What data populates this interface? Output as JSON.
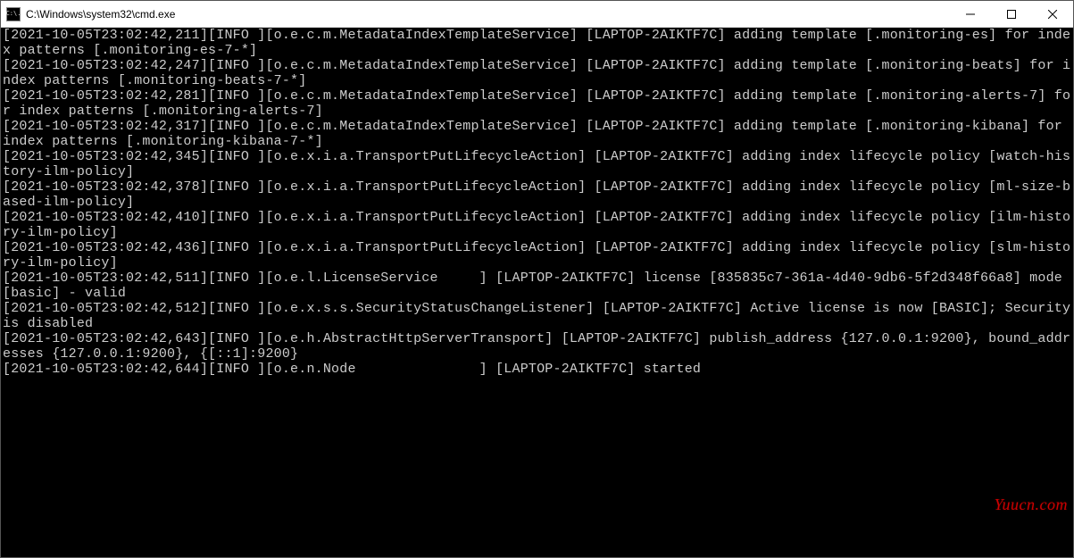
{
  "window": {
    "title": "C:\\Windows\\system32\\cmd.exe",
    "app_icon_label": "C:\\."
  },
  "controls": {
    "minimize": "Minimize",
    "maximize": "Maximize",
    "close": "Close"
  },
  "watermark": "Yuucn.com",
  "console_lines": [
    "[2021-10-05T23:02:42,211][INFO ][o.e.c.m.MetadataIndexTemplateService] [LAPTOP-2AIKTF7C] adding template [.monitoring-es] for index patterns [.monitoring-es-7-*]",
    "[2021-10-05T23:02:42,247][INFO ][o.e.c.m.MetadataIndexTemplateService] [LAPTOP-2AIKTF7C] adding template [.monitoring-beats] for index patterns [.monitoring-beats-7-*]",
    "[2021-10-05T23:02:42,281][INFO ][o.e.c.m.MetadataIndexTemplateService] [LAPTOP-2AIKTF7C] adding template [.monitoring-alerts-7] for index patterns [.monitoring-alerts-7]",
    "[2021-10-05T23:02:42,317][INFO ][o.e.c.m.MetadataIndexTemplateService] [LAPTOP-2AIKTF7C] adding template [.monitoring-kibana] for index patterns [.monitoring-kibana-7-*]",
    "[2021-10-05T23:02:42,345][INFO ][o.e.x.i.a.TransportPutLifecycleAction] [LAPTOP-2AIKTF7C] adding index lifecycle policy [watch-history-ilm-policy]",
    "[2021-10-05T23:02:42,378][INFO ][o.e.x.i.a.TransportPutLifecycleAction] [LAPTOP-2AIKTF7C] adding index lifecycle policy [ml-size-based-ilm-policy]",
    "[2021-10-05T23:02:42,410][INFO ][o.e.x.i.a.TransportPutLifecycleAction] [LAPTOP-2AIKTF7C] adding index lifecycle policy [ilm-history-ilm-policy]",
    "[2021-10-05T23:02:42,436][INFO ][o.e.x.i.a.TransportPutLifecycleAction] [LAPTOP-2AIKTF7C] adding index lifecycle policy [slm-history-ilm-policy]",
    "[2021-10-05T23:02:42,511][INFO ][o.e.l.LicenseService     ] [LAPTOP-2AIKTF7C] license [835835c7-361a-4d40-9db6-5f2d348f66a8] mode [basic] - valid",
    "[2021-10-05T23:02:42,512][INFO ][o.e.x.s.s.SecurityStatusChangeListener] [LAPTOP-2AIKTF7C] Active license is now [BASIC]; Security is disabled",
    "[2021-10-05T23:02:42,643][INFO ][o.e.h.AbstractHttpServerTransport] [LAPTOP-2AIKTF7C] publish_address {127.0.0.1:9200}, bound_addresses {127.0.0.1:9200}, {[::1]:9200}",
    "[2021-10-05T23:02:42,644][INFO ][o.e.n.Node               ] [LAPTOP-2AIKTF7C] started"
  ]
}
